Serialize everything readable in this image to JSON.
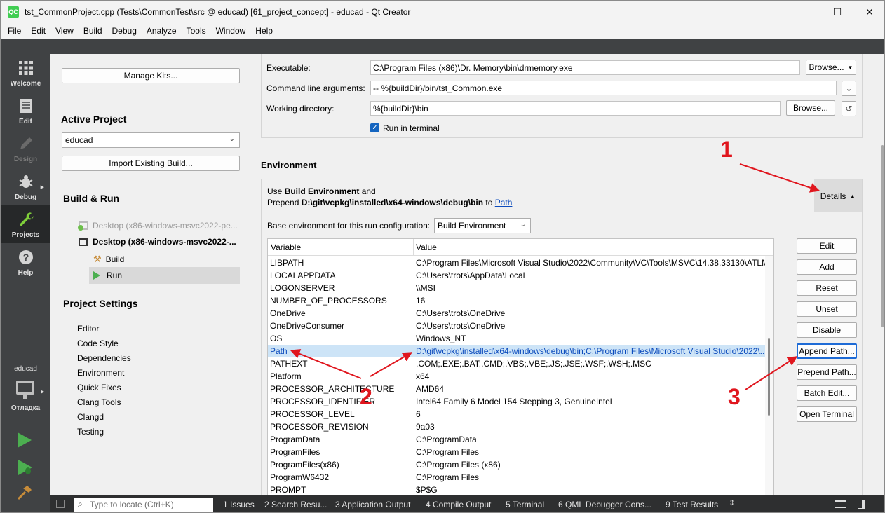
{
  "window": {
    "app_icon": "QC",
    "title": "tst_CommonProject.cpp (Tests\\CommonTest\\src @ educad) [61_project_concept] - educad - Qt Creator",
    "controls": [
      "—",
      "☐",
      "✕"
    ]
  },
  "menu": [
    "File",
    "Edit",
    "View",
    "Build",
    "Debug",
    "Analyze",
    "Tools",
    "Window",
    "Help"
  ],
  "modes": [
    {
      "label": "Welcome",
      "icon": "grid-icon"
    },
    {
      "label": "Edit",
      "icon": "document-icon"
    },
    {
      "label": "Design",
      "icon": "pencil-icon"
    },
    {
      "label": "Debug",
      "icon": "bug-icon"
    },
    {
      "label": "Projects",
      "icon": "wrench-icon"
    },
    {
      "label": "Help",
      "icon": "question-icon"
    }
  ],
  "kit_selector": {
    "project": "educad",
    "config": "Отладка"
  },
  "sidebar": {
    "manage_kits": "Manage Kits...",
    "active_project_heading": "Active Project",
    "active_project_value": "educad",
    "import_build": "Import Existing Build...",
    "build_run_heading": "Build & Run",
    "kit_disabled": "Desktop (x86-windows-msvc2022-pe...",
    "kit_active": "Desktop (x86-windows-msvc2022-...",
    "build_item": "Build",
    "run_item": "Run",
    "project_settings_heading": "Project Settings",
    "settings_items": [
      "Editor",
      "Code Style",
      "Dependencies",
      "Environment",
      "Quick Fixes",
      "Clang Tools",
      "Clangd",
      "Testing"
    ]
  },
  "run_config": {
    "executable_label": "Executable:",
    "executable_value": "C:\\Program Files (x86)\\Dr. Memory\\bin\\drmemory.exe",
    "browse_dropdown": "Browse...",
    "args_label": "Command line arguments:",
    "args_value": "-- %{buildDir}/bin/tst_Common.exe",
    "workdir_label": "Working directory:",
    "workdir_value": "%{buildDir}\\bin",
    "browse": "Browse...",
    "run_in_terminal": "Run in terminal"
  },
  "environment": {
    "heading": "Environment",
    "summary_use": "Use ",
    "summary_build_env": "Build Environment",
    "summary_and": " and",
    "summary_prepend": "Prepend ",
    "summary_path_value": "D:\\git\\vcpkg\\installed\\x64-windows\\debug\\bin",
    "summary_to": " to ",
    "summary_path_link": "Path",
    "details": "Details",
    "base_env_label": "Base environment for this run configuration:",
    "base_env_value": "Build Environment",
    "col_variable": "Variable",
    "col_value": "Value",
    "rows": [
      {
        "var": "LIBPATH",
        "val": "C:\\Program Files\\Microsoft Visual Studio\\2022\\Community\\VC\\Tools\\MSVC\\14.38.33130\\ATLM..."
      },
      {
        "var": "LOCALAPPDATA",
        "val": "C:\\Users\\trots\\AppData\\Local"
      },
      {
        "var": "LOGONSERVER",
        "val": "\\\\MSI"
      },
      {
        "var": "NUMBER_OF_PROCESSORS",
        "val": "16"
      },
      {
        "var": "OneDrive",
        "val": "C:\\Users\\trots\\OneDrive"
      },
      {
        "var": "OneDriveConsumer",
        "val": "C:\\Users\\trots\\OneDrive"
      },
      {
        "var": "OS",
        "val": "Windows_NT"
      },
      {
        "var": "Path",
        "val": "D:\\git\\vcpkg\\installed\\x64-windows\\debug\\bin;C:\\Program Files\\Microsoft Visual Studio\\2022\\..."
      },
      {
        "var": "PATHEXT",
        "val": ".COM;.EXE;.BAT;.CMD;.VBS;.VBE;.JS;.JSE;.WSF;.WSH;.MSC"
      },
      {
        "var": "Platform",
        "val": "x64"
      },
      {
        "var": "PROCESSOR_ARCHITECTURE",
        "val": "AMD64"
      },
      {
        "var": "PROCESSOR_IDENTIFIER",
        "val": "Intel64 Family 6 Model 154 Stepping 3, GenuineIntel"
      },
      {
        "var": "PROCESSOR_LEVEL",
        "val": "6"
      },
      {
        "var": "PROCESSOR_REVISION",
        "val": "9a03"
      },
      {
        "var": "ProgramData",
        "val": "C:\\ProgramData"
      },
      {
        "var": "ProgramFiles",
        "val": "C:\\Program Files"
      },
      {
        "var": "ProgramFiles(x86)",
        "val": "C:\\Program Files (x86)"
      },
      {
        "var": "ProgramW6432",
        "val": "C:\\Program Files"
      },
      {
        "var": "PROMPT",
        "val": "$P$G"
      }
    ],
    "selected_row": "Path",
    "buttons": [
      "Edit",
      "Add",
      "Reset",
      "Unset",
      "Disable",
      "Append Path...",
      "Prepend Path...",
      "Batch Edit...",
      "Open Terminal"
    ]
  },
  "bottom_bar": {
    "locator_placeholder": "Type to locate (Ctrl+K)",
    "tabs": [
      "1  Issues",
      "2  Search Resu...",
      "3  Application Output",
      "4  Compile Output",
      "5  Terminal",
      "6  QML Debugger Cons...",
      "9  Test Results"
    ]
  },
  "annotations": [
    "1",
    "2",
    "3"
  ],
  "colors": {
    "accent": "#1e6bd6",
    "annotation": "#e0161e",
    "modebar": "#404244",
    "selection": "#cde4f7"
  }
}
